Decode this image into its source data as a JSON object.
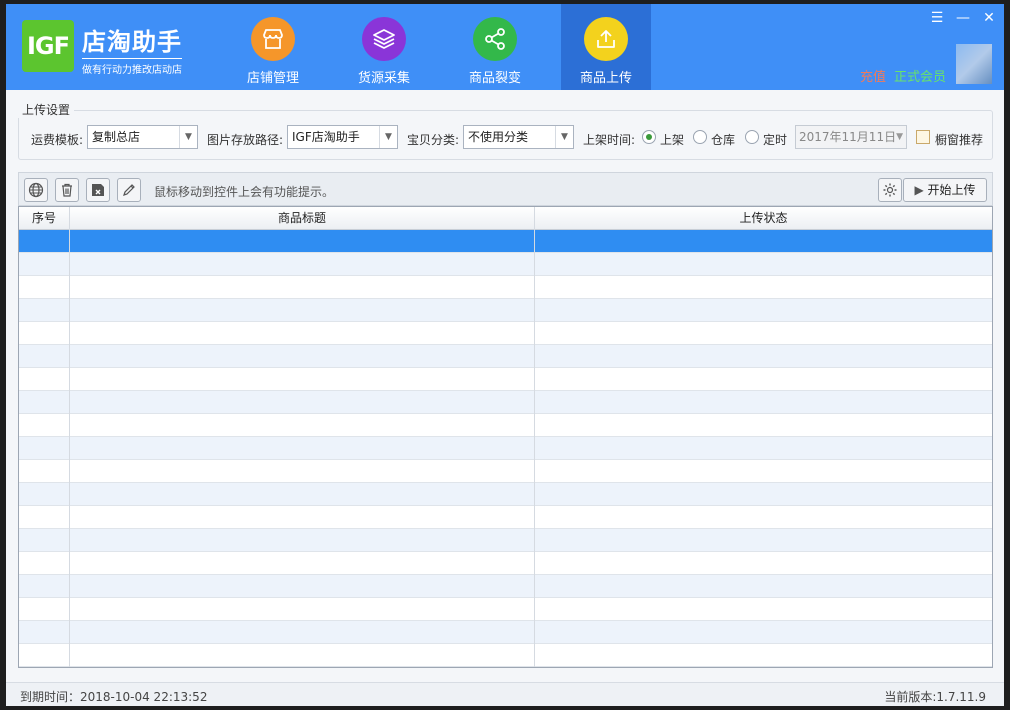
{
  "app": {
    "logo_text": "IGF",
    "brand_name": "店淘助手",
    "brand_sub": "做有行动力推改店动店"
  },
  "nav": [
    {
      "label": "店铺管理",
      "icon": "store-icon",
      "color": "#f5962a"
    },
    {
      "label": "货源采集",
      "icon": "layers-icon",
      "color": "#8a35d8"
    },
    {
      "label": "商品裂变",
      "icon": "share-icon",
      "color": "#33b84a"
    },
    {
      "label": "商品上传",
      "icon": "upload-icon",
      "color": "#f3d21d"
    }
  ],
  "member": {
    "recharge": "充值",
    "status": "正式会员"
  },
  "settings": {
    "legend": "上传设置",
    "freight_label": "运费模板:",
    "freight_value": "复制总店",
    "image_path_label": "图片存放路径:",
    "image_path_value": "IGF店淘助手",
    "category_label": "宝贝分类:",
    "category_value": "不使用分类",
    "listing_time_label": "上架时间:",
    "radio_shelf": "上架",
    "radio_warehouse": "仓库",
    "radio_scheduled": "定时",
    "date_value": "2017年11月11日",
    "window_recommend": "橱窗推荐"
  },
  "toolbar": {
    "hint": "鼠标移动到控件上会有功能提示。",
    "start_upload": "开始上传"
  },
  "table": {
    "columns": [
      "序号",
      "商品标题",
      "上传状态"
    ],
    "row_count": 19
  },
  "status": {
    "expire": "到期时间：2018-10-04 22:13:52",
    "version": "当前版本:1.7.11.9"
  },
  "colors": {
    "header": "#3f8ff7",
    "selected_row": "#2f8df2",
    "recharge": "#f07a5a",
    "member": "#68e36a"
  }
}
